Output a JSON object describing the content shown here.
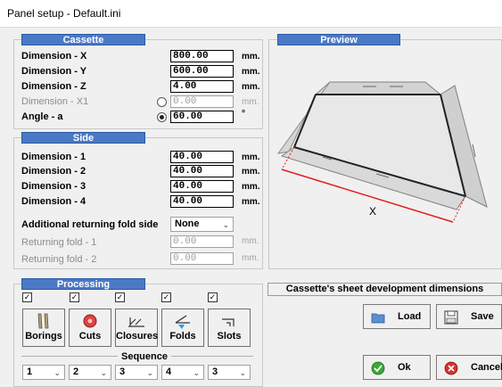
{
  "window": {
    "title": "Panel setup - Default.ini"
  },
  "cassette": {
    "header": "Cassette",
    "rows": [
      {
        "label": "Dimension - X",
        "value": "800.00",
        "unit": "mm."
      },
      {
        "label": "Dimension - Y",
        "value": "600.00",
        "unit": "mm."
      },
      {
        "label": "Dimension - Z",
        "value": "4.00",
        "unit": "mm."
      },
      {
        "label": "Dimension - X1",
        "value": "0.00",
        "unit": "mm."
      },
      {
        "label": "Angle - a",
        "value": "60.00",
        "unit": "°"
      }
    ]
  },
  "side": {
    "header": "Side",
    "rows": [
      {
        "label": "Dimension - 1",
        "value": "40.00",
        "unit": "mm."
      },
      {
        "label": "Dimension - 2",
        "value": "40.00",
        "unit": "mm."
      },
      {
        "label": "Dimension - 3",
        "value": "40.00",
        "unit": "mm."
      },
      {
        "label": "Dimension - 4",
        "value": "40.00",
        "unit": "mm."
      }
    ],
    "returning_side_label": "Additional returning fold side",
    "returning_side_value": "None",
    "returning": [
      {
        "label": "Returning fold - 1",
        "value": "0.00",
        "unit": "mm."
      },
      {
        "label": "Returning fold - 2",
        "value": "0.00",
        "unit": "mm."
      }
    ]
  },
  "preview": {
    "header": "Preview",
    "dimension_label": "X"
  },
  "processing": {
    "header": "Processing",
    "buttons": [
      {
        "label": "Borings",
        "icon": "drill-icon"
      },
      {
        "label": "Cuts",
        "icon": "saw-blade-icon"
      },
      {
        "label": "Closures",
        "icon": "closure-icon"
      },
      {
        "label": "Folds",
        "icon": "fold-icon"
      },
      {
        "label": "Slots",
        "icon": "slot-icon"
      }
    ],
    "sequence_label": "Sequence",
    "sequence_values": [
      "1",
      "2",
      "3",
      "4",
      "3"
    ]
  },
  "actions": {
    "dev_label": "Cassette's sheet development dimensions",
    "load": "Load",
    "save": "Save",
    "ok": "Ok",
    "cancel": "Cancel"
  }
}
